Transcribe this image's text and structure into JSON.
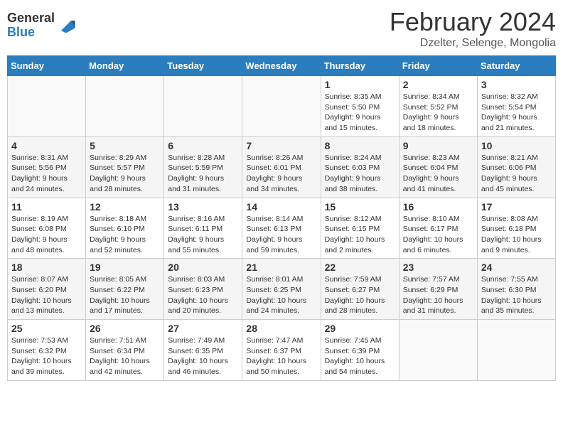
{
  "logo": {
    "general": "General",
    "blue": "Blue"
  },
  "title": "February 2024",
  "subtitle": "Dzelter, Selenge, Mongolia",
  "days_of_week": [
    "Sunday",
    "Monday",
    "Tuesday",
    "Wednesday",
    "Thursday",
    "Friday",
    "Saturday"
  ],
  "weeks": [
    [
      {
        "day": "",
        "empty": true
      },
      {
        "day": "",
        "empty": true
      },
      {
        "day": "",
        "empty": true
      },
      {
        "day": "",
        "empty": true
      },
      {
        "day": "1",
        "sunrise": "8:35 AM",
        "sunset": "5:50 PM",
        "daylight": "9 hours and 15 minutes."
      },
      {
        "day": "2",
        "sunrise": "8:34 AM",
        "sunset": "5:52 PM",
        "daylight": "9 hours and 18 minutes."
      },
      {
        "day": "3",
        "sunrise": "8:32 AM",
        "sunset": "5:54 PM",
        "daylight": "9 hours and 21 minutes."
      }
    ],
    [
      {
        "day": "4",
        "sunrise": "8:31 AM",
        "sunset": "5:56 PM",
        "daylight": "9 hours and 24 minutes."
      },
      {
        "day": "5",
        "sunrise": "8:29 AM",
        "sunset": "5:57 PM",
        "daylight": "9 hours and 28 minutes."
      },
      {
        "day": "6",
        "sunrise": "8:28 AM",
        "sunset": "5:59 PM",
        "daylight": "9 hours and 31 minutes."
      },
      {
        "day": "7",
        "sunrise": "8:26 AM",
        "sunset": "6:01 PM",
        "daylight": "9 hours and 34 minutes."
      },
      {
        "day": "8",
        "sunrise": "8:24 AM",
        "sunset": "6:03 PM",
        "daylight": "9 hours and 38 minutes."
      },
      {
        "day": "9",
        "sunrise": "8:23 AM",
        "sunset": "6:04 PM",
        "daylight": "9 hours and 41 minutes."
      },
      {
        "day": "10",
        "sunrise": "8:21 AM",
        "sunset": "6:06 PM",
        "daylight": "9 hours and 45 minutes."
      }
    ],
    [
      {
        "day": "11",
        "sunrise": "8:19 AM",
        "sunset": "6:08 PM",
        "daylight": "9 hours and 48 minutes."
      },
      {
        "day": "12",
        "sunrise": "8:18 AM",
        "sunset": "6:10 PM",
        "daylight": "9 hours and 52 minutes."
      },
      {
        "day": "13",
        "sunrise": "8:16 AM",
        "sunset": "6:11 PM",
        "daylight": "9 hours and 55 minutes."
      },
      {
        "day": "14",
        "sunrise": "8:14 AM",
        "sunset": "6:13 PM",
        "daylight": "9 hours and 59 minutes."
      },
      {
        "day": "15",
        "sunrise": "8:12 AM",
        "sunset": "6:15 PM",
        "daylight": "10 hours and 2 minutes."
      },
      {
        "day": "16",
        "sunrise": "8:10 AM",
        "sunset": "6:17 PM",
        "daylight": "10 hours and 6 minutes."
      },
      {
        "day": "17",
        "sunrise": "8:08 AM",
        "sunset": "6:18 PM",
        "daylight": "10 hours and 9 minutes."
      }
    ],
    [
      {
        "day": "18",
        "sunrise": "8:07 AM",
        "sunset": "6:20 PM",
        "daylight": "10 hours and 13 minutes."
      },
      {
        "day": "19",
        "sunrise": "8:05 AM",
        "sunset": "6:22 PM",
        "daylight": "10 hours and 17 minutes."
      },
      {
        "day": "20",
        "sunrise": "8:03 AM",
        "sunset": "6:23 PM",
        "daylight": "10 hours and 20 minutes."
      },
      {
        "day": "21",
        "sunrise": "8:01 AM",
        "sunset": "6:25 PM",
        "daylight": "10 hours and 24 minutes."
      },
      {
        "day": "22",
        "sunrise": "7:59 AM",
        "sunset": "6:27 PM",
        "daylight": "10 hours and 28 minutes."
      },
      {
        "day": "23",
        "sunrise": "7:57 AM",
        "sunset": "6:29 PM",
        "daylight": "10 hours and 31 minutes."
      },
      {
        "day": "24",
        "sunrise": "7:55 AM",
        "sunset": "6:30 PM",
        "daylight": "10 hours and 35 minutes."
      }
    ],
    [
      {
        "day": "25",
        "sunrise": "7:53 AM",
        "sunset": "6:32 PM",
        "daylight": "10 hours and 39 minutes."
      },
      {
        "day": "26",
        "sunrise": "7:51 AM",
        "sunset": "6:34 PM",
        "daylight": "10 hours and 42 minutes."
      },
      {
        "day": "27",
        "sunrise": "7:49 AM",
        "sunset": "6:35 PM",
        "daylight": "10 hours and 46 minutes."
      },
      {
        "day": "28",
        "sunrise": "7:47 AM",
        "sunset": "6:37 PM",
        "daylight": "10 hours and 50 minutes."
      },
      {
        "day": "29",
        "sunrise": "7:45 AM",
        "sunset": "6:39 PM",
        "daylight": "10 hours and 54 minutes."
      },
      {
        "day": "",
        "empty": true
      },
      {
        "day": "",
        "empty": true
      }
    ]
  ]
}
